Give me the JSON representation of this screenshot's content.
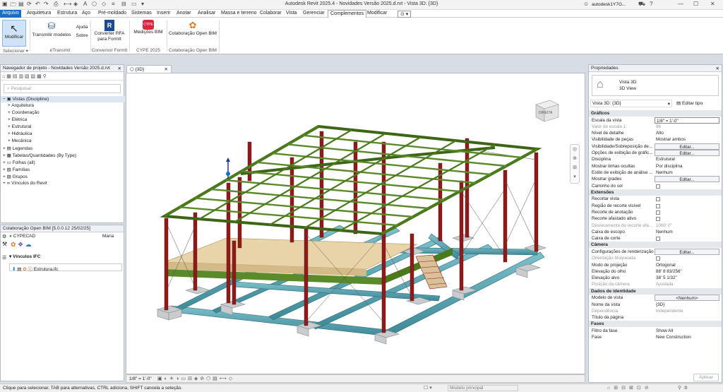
{
  "app": {
    "title": "Autodesk Revit 2025.4 - Novidades Versão 2025.d.rvt - Vista 3D: {3D}",
    "user": "autodesk1Y7G..."
  },
  "menu": [
    "Arquivo",
    "Arquitetura",
    "Estrutura",
    "Aço",
    "Pré-moldado",
    "Sistemas",
    "Inserir",
    "Anotar",
    "Analisar",
    "Massa e terreno",
    "Colaborar",
    "Vista",
    "Gerenciar",
    "Complementos",
    "Modificar"
  ],
  "ribbon": {
    "modificar": "Modificar",
    "selecionar": "Selecionar",
    "transmitir": "Transmitir modelos",
    "ajuda": "Ajuda",
    "sobre": "Sobre",
    "etransmit": "eTransmit",
    "converter": "Converter RFA para FormIt",
    "conversor": "Conversor FormIt",
    "medicoes": "Medições BIM",
    "cype": "CYPE 2025",
    "colab": "Colaboração Open BIM",
    "colab_group": "Colaboração Open BIM"
  },
  "navigator": {
    "title": "Navegador de projeto - Novidades Versão 2025.d.rvt",
    "search_placeholder": "Pesquisar",
    "items": [
      "Vistas (Discipline)",
      "Arquitetura",
      "Coordenação",
      "Elétrica",
      "Estrutural",
      "Hidráulica",
      "Mecânica",
      "Legendas",
      "Tabelas/Quantidades (By Type)",
      "Folhas (all)",
      "Famílias",
      "Grupos",
      "Vínculos do Revit"
    ]
  },
  "openbim": {
    "title": "Colaboração Open BIM [5.0.0.12 25/02/25]",
    "app": "CYPECAD",
    "user": "Maria",
    "links": "Vínculos IFC",
    "file": "Estrutura.ifc"
  },
  "view": {
    "tab": "{3D}",
    "scale": "1/8\" = 1'-0\"",
    "cube_label": "DIREITA"
  },
  "properties": {
    "title": "Propriedades",
    "type_name": "Vista 3D",
    "type_sub": "3D View",
    "selector": "Vista 3D: {3D}",
    "edit_type": "Editar tipo",
    "apply": "Aplicar",
    "rows": [
      {
        "cat": "Gráficos"
      },
      {
        "k": "Escala da vista",
        "v": "1/8\" = 1'-0\""
      },
      {
        "k": "Valor de escala    1:",
        "v": "96",
        "grey": true
      },
      {
        "k": "Nível de detalhe",
        "v": "Alto"
      },
      {
        "k": "Visibilidade de peças",
        "v": "Mostrar ambos"
      },
      {
        "k": "Visibilidade/Sobreposição de...",
        "v": "Editar...",
        "btn": true
      },
      {
        "k": "Opções de exibição de gráfic...",
        "v": "Editar...",
        "btn": true
      },
      {
        "k": "Disciplina",
        "v": "Estrutural"
      },
      {
        "k": "Mostrar linhas ocultas",
        "v": "Por disciplina"
      },
      {
        "k": "Estilo de exibição de análise ...",
        "v": "Nenhum"
      },
      {
        "k": "Mostrar grades",
        "v": "Editar...",
        "btn": true
      },
      {
        "k": "Caminho do sol",
        "v": "",
        "chk": true
      },
      {
        "cat": "Extensões"
      },
      {
        "k": "Recortar vista",
        "v": "",
        "chk": true
      },
      {
        "k": "Região de recorte visível",
        "v": "",
        "chk": true
      },
      {
        "k": "Recorte de anotação",
        "v": "",
        "chk": true
      },
      {
        "k": "Recorte afastado ativo",
        "v": "",
        "chk": true
      },
      {
        "k": "Deslocamento do recorte afa...",
        "v": "1000' 0\"",
        "grey": true
      },
      {
        "k": "Caixa de escopo",
        "v": "Nenhum"
      },
      {
        "k": "Caixa de corte",
        "v": "",
        "chk": true
      },
      {
        "cat": "Câmera"
      },
      {
        "k": "Configurações de renderização",
        "v": "Editar...",
        "btn": true
      },
      {
        "k": "Orientação bloqueada",
        "v": "",
        "chk": true,
        "grey": true
      },
      {
        "k": "Modo de projeção",
        "v": "Ortogonal"
      },
      {
        "k": "Elevação do olho",
        "v": "88' 8 83/256\""
      },
      {
        "k": "Elevação alvo",
        "v": "38' 5 1/32\""
      },
      {
        "k": "Posição da câmera",
        "v": "Ajustada",
        "grey": true
      },
      {
        "cat": "Dados de identidade"
      },
      {
        "k": "Modelo de vista",
        "v": "<Nenhum>",
        "btn": true
      },
      {
        "k": "Nome da vista",
        "v": "{3D}"
      },
      {
        "k": "Dependência",
        "v": "Independente",
        "grey": true
      },
      {
        "k": "Título da página",
        "v": ""
      },
      {
        "cat": "Fases"
      },
      {
        "k": "Filtro da fase",
        "v": "Show All"
      },
      {
        "k": "Fase",
        "v": "New Construction"
      }
    ]
  },
  "status": {
    "text": "Clique para selecionar, TAB para alternativas, CTRL adiciona, SHIFT cancela a seleção.",
    "model": "Modelo principal",
    "zero": ":0"
  },
  "colors": {
    "accent": "#1a6fc4",
    "steel_green": "#4a7a1c",
    "column_red": "#8e1a1a",
    "foundation_teal": "#5ea6b3",
    "slab": "#e6d2a6"
  }
}
